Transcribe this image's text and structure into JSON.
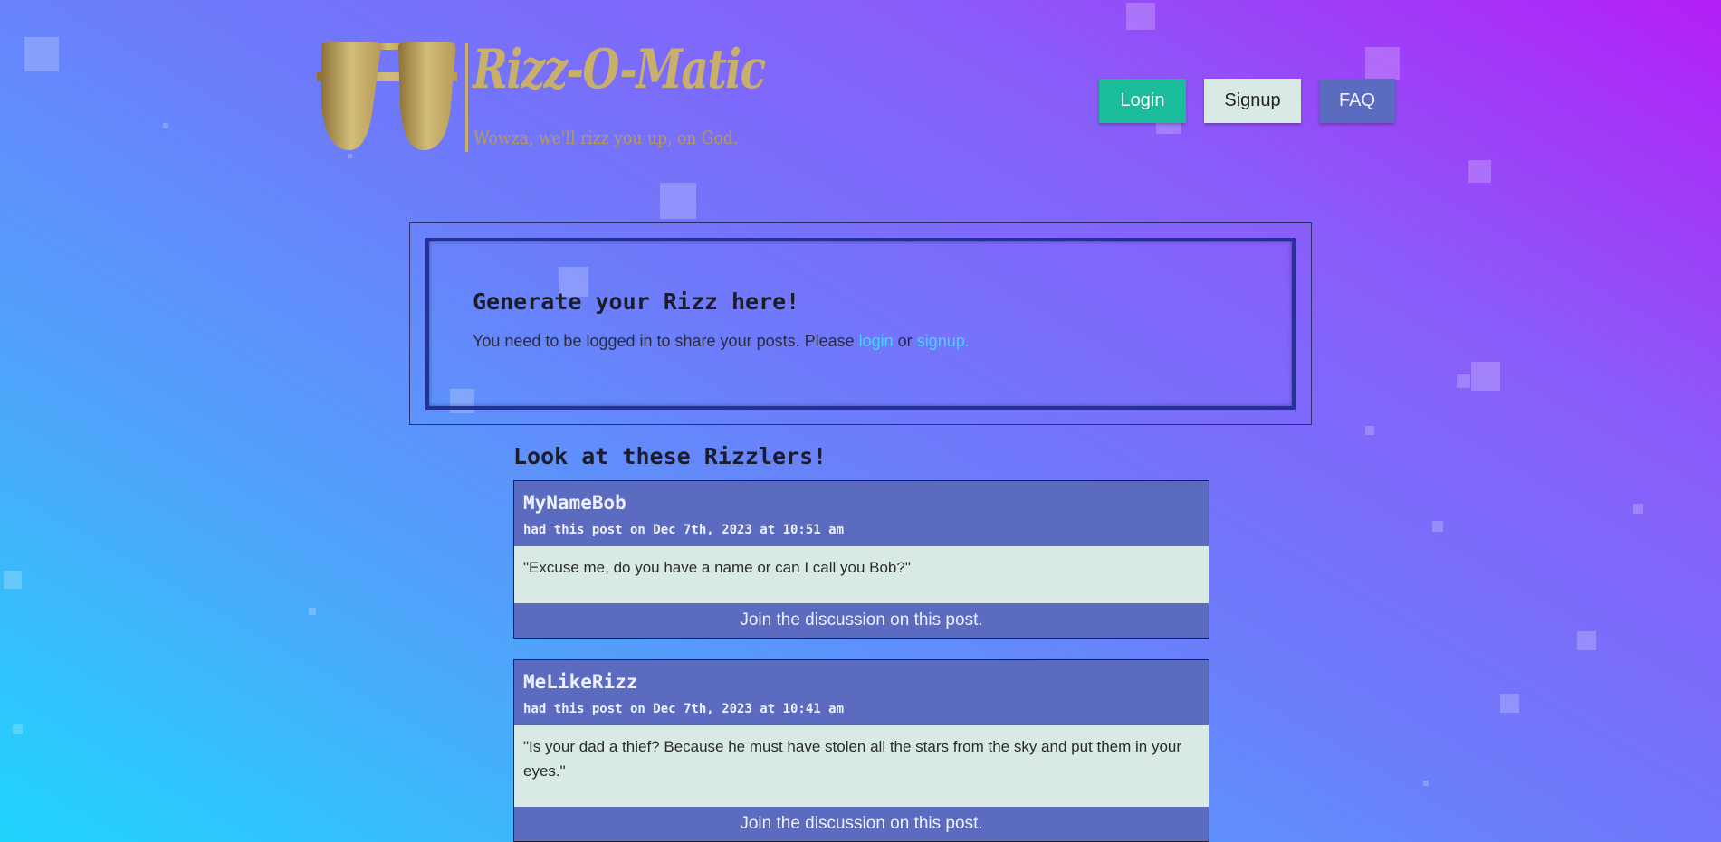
{
  "brand": {
    "name": "Rizz-O-Matic",
    "tagline": "Wowza, we'll rizz you up, on God.",
    "logo_icon": "aviator-sunglasses-icon",
    "gold": "#c9b06a"
  },
  "nav": {
    "login": "Login",
    "signup": "Signup",
    "faq": "FAQ"
  },
  "generator": {
    "title": "Generate your Rizz here!",
    "notice_prefix": "You need to be logged in to share your posts. Please ",
    "login_link": "login",
    "notice_or": " or ",
    "signup_link": "signup."
  },
  "feed": {
    "title": "Look at these Rizzlers!",
    "posts": [
      {
        "user": "MyNameBob",
        "meta": "had this post on Dec 7th, 2023 at 10:51 am",
        "body": "\"Excuse me, do you have a name or can I call you Bob?\"",
        "link": "Join the discussion on this post."
      },
      {
        "user": "MeLikeRizz",
        "meta": "had this post on Dec 7th, 2023 at 10:41 am",
        "body": "\"Is your dad a thief? Because he must have stolen all the stars from the sky and put them in your eyes.\"",
        "link": "Join the discussion on this post."
      }
    ]
  },
  "colors": {
    "login_button": "#1abc9c",
    "signup_button": "#d8e9e6",
    "faq_button": "#5b6cc0",
    "post_header": "#5b6cc0",
    "post_body": "#d8e9e6",
    "link": "#46d4ff"
  }
}
